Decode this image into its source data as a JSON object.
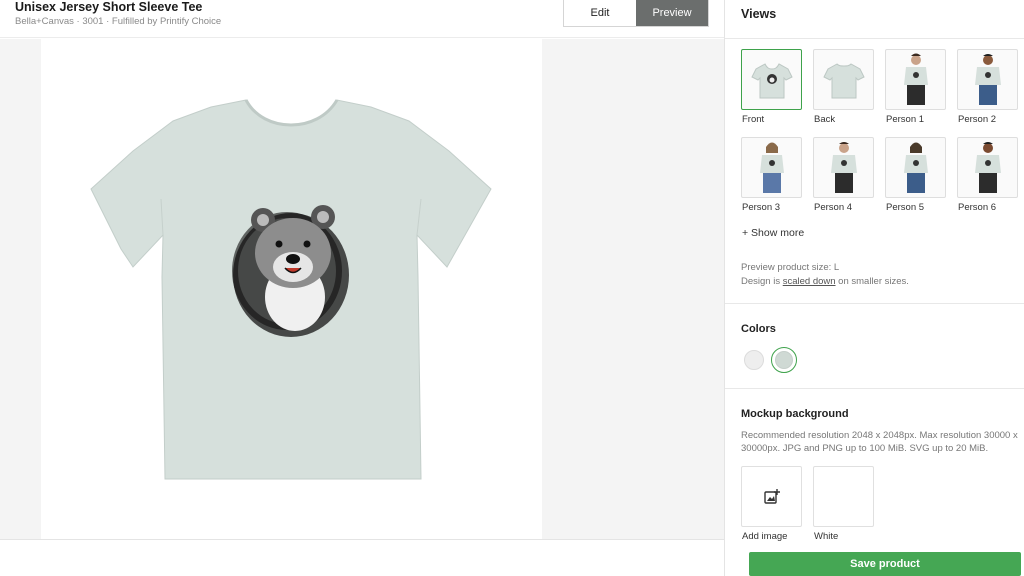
{
  "product": {
    "title": "Unisex Jersey Short Sleeve Tee",
    "subtitle": "Bella+Canvas · 3001 · Fulfilled by Printify Choice"
  },
  "tabs": {
    "edit": "Edit",
    "preview": "Preview",
    "active": "Preview"
  },
  "views": {
    "heading": "Views",
    "items": [
      {
        "label": "Front",
        "selected": true,
        "icon": "tshirt-front-icon"
      },
      {
        "label": "Back",
        "selected": false,
        "icon": "tshirt-back-icon"
      },
      {
        "label": "Person 1",
        "selected": false,
        "icon": "person-icon"
      },
      {
        "label": "Person 2",
        "selected": false,
        "icon": "person-icon"
      },
      {
        "label": "Person 3",
        "selected": false,
        "icon": "person-icon"
      },
      {
        "label": "Person 4",
        "selected": false,
        "icon": "person-icon"
      },
      {
        "label": "Person 5",
        "selected": false,
        "icon": "person-icon"
      },
      {
        "label": "Person 6",
        "selected": false,
        "icon": "person-icon"
      }
    ],
    "show_more": "+ Show more",
    "size_note": "Preview product size: L",
    "design_note_prefix": "Design is ",
    "design_note_link": "scaled down",
    "design_note_suffix": " on smaller sizes."
  },
  "colors": {
    "heading": "Colors",
    "swatches": [
      {
        "hex": "#eeeeee",
        "selected": false
      },
      {
        "hex": "#cfd9d4",
        "selected": true
      }
    ]
  },
  "mockup_background": {
    "heading": "Mockup background",
    "note": "Recommended resolution 2048 x 2048px. Max resolution 30000 x 30000px. JPG and PNG up to 100 MiB. SVG up to 20 MiB.",
    "add_image": "Add image",
    "white": "White"
  },
  "save_button": "Save product",
  "theme": {
    "accent": "#45a754",
    "shirt": "#d6e0dc"
  }
}
